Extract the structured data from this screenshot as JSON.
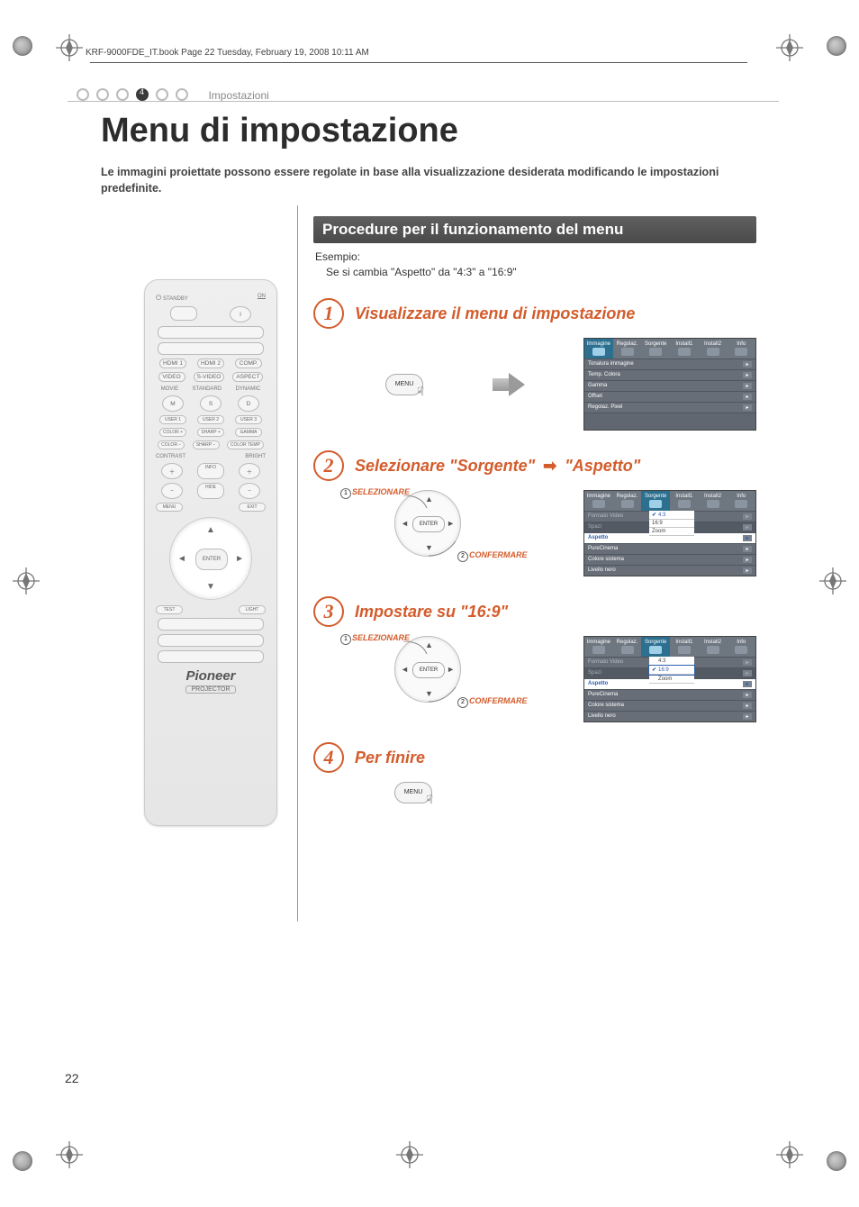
{
  "bookline": "KRF-9000FDE_IT.book  Page 22  Tuesday, February 19, 2008  10:11 AM",
  "header": {
    "chapter_num": "4",
    "chapter_label": "Impostazioni"
  },
  "title": "Menu di impostazione",
  "intro": "Le immagini proiettate possono essere regolate in base alla visualizzazione desiderata modificando le impostazioni predefinite.",
  "procedures_band": "Procedure per il funzionamento del menu",
  "example": {
    "label": "Esempio:",
    "text": "Se si cambia \"Aspetto\" da \"4:3\" a \"16:9\""
  },
  "steps": {
    "s1": "Visualizzare il menu di impostazione",
    "s2_a": "Selezionare \"Sorgente\"",
    "s2_b": "\"Aspetto\"",
    "s3": "Impostare su \"16:9\"",
    "s4": "Per finire"
  },
  "labels": {
    "selezionare": "SELEZIONARE",
    "confermare": "CONFERMARE",
    "menu": "MENU",
    "enter": "ENTER"
  },
  "remote": {
    "standby": "STANDBY",
    "on": "ON",
    "hdmi1": "HDMI 1",
    "hdmi2": "HDMI 2",
    "comp": "COMP.",
    "video": "VIDEO",
    "svideo": "S-VIDEO",
    "aspect": "ASPECT",
    "movie": "MOVIE",
    "standard": "STANDARD",
    "dynamic": "DYNAMIC",
    "m": "M",
    "s": "S",
    "d": "D",
    "user1": "USER 1",
    "user2": "USER 2",
    "user3": "USER 3",
    "color_p": "COLOR +",
    "sharp_p": "SHARP +",
    "gamma": "GAMMA",
    "color_m": "COLOR −",
    "sharp_m": "SHARP −",
    "ctemp": "COLOR TEMP",
    "contrast": "CONTRAST",
    "bright": "BRIGHT",
    "info": "INFO",
    "hide": "HIDE",
    "menu": "MENU",
    "exit": "EXIT",
    "enter": "ENTER",
    "test": "TEST",
    "light": "LIGHT",
    "brand": "Pioneer",
    "projector": "PROJECTOR"
  },
  "osd": {
    "tabs": [
      "Immagine",
      "Regolaz.",
      "Sorgente",
      "Install1",
      "Install2",
      "Info"
    ],
    "menu1": [
      "Tonalura immagine",
      "Temp. Colora",
      "Gamma",
      "Offset",
      "Regolaz. Pixel"
    ],
    "menu2": {
      "rows": [
        "Formato Video",
        "Spazi",
        "Aspetto",
        "PureCinema",
        "Colore sistema",
        "Livello nero"
      ],
      "opts": [
        "4:3",
        "16:9",
        "Zoom"
      ]
    }
  },
  "page_number": "22"
}
